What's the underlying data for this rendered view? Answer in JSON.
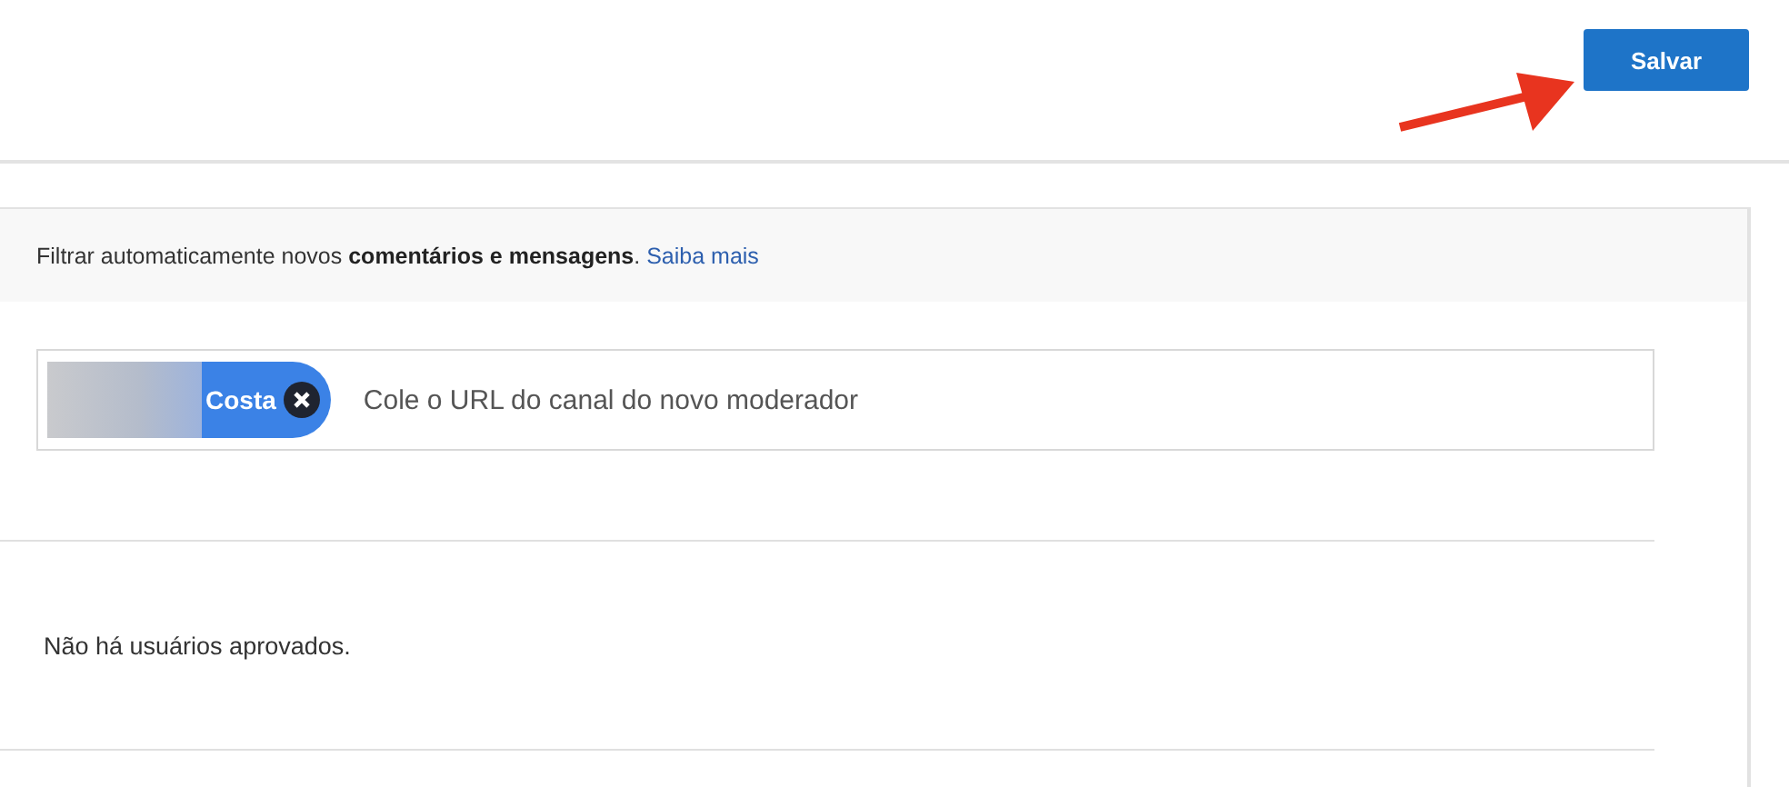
{
  "header": {
    "save_button": "Salvar"
  },
  "filter_notice": {
    "text": "Filtrar automaticamente novos **comentários e mensagens**.",
    "link": "Saiba mais"
  },
  "moderator_field": {
    "chips": [
      {
        "label": "Costa"
      }
    ],
    "placeholder": "Cole o URL do canal do novo moderador"
  },
  "approved_users": {
    "empty_message": "Não há usuários aprovados."
  }
}
